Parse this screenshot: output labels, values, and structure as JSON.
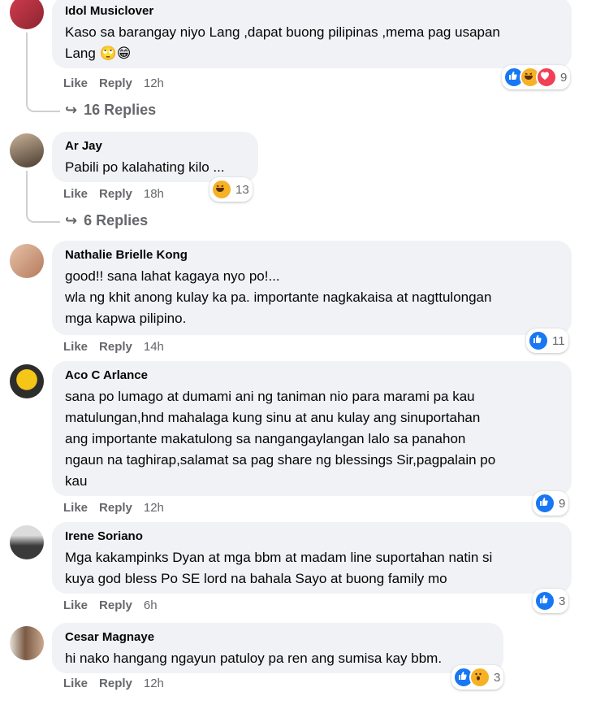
{
  "actions": {
    "like_label": "Like",
    "reply_label": "Reply"
  },
  "comments": [
    {
      "author": "Idol Musiclover",
      "text": "Kaso sa barangay niyo Lang ,dapat buong pilipinas ,mema pag usapan\nLang 🙄😁",
      "time": "12h",
      "reactions": [
        "like-icon",
        "haha-icon",
        "love-icon"
      ],
      "reaction_count": "9",
      "replies": "16 Replies"
    },
    {
      "author": "Ar Jay",
      "text": "Pabili po kalahating kilo ...",
      "time": "18h",
      "reactions": [
        "haha-icon"
      ],
      "reaction_count": "13",
      "replies": "6 Replies"
    },
    {
      "author": "Nathalie Brielle Kong",
      "text": "good!! sana lahat kagaya nyo po!...\nwla ng khit anong kulay ka pa. importante nagkakaisa at nagttulongan\nmga kapwa pilipino.",
      "time": "14h",
      "reactions": [
        "like-icon"
      ],
      "reaction_count": "11"
    },
    {
      "author": "Aco C Arlance",
      "text": "sana po lumago at dumami ani ng taniman nio para marami pa kau\nmatulungan,hnd mahalaga kung sinu at anu kulay ang sinuportahan\nang importante makatulong sa nangangaylangan lalo sa panahon\nngaun na taghirap,salamat sa pag share ng blessings Sir,pagpalain po\nkau",
      "time": "12h",
      "reactions": [
        "like-icon"
      ],
      "reaction_count": "9"
    },
    {
      "author": "Irene Soriano",
      "text": "Mga kakampinks Dyan at mga bbm at madam line suportahan natin si\nkuya god bless Po SE lord na bahala Sayo at buong family mo",
      "time": "6h",
      "reactions": [
        "like-icon"
      ],
      "reaction_count": "3"
    },
    {
      "author": "Cesar Magnaye",
      "text": "hi nako hangang ngayun patuloy pa ren ang sumisa kay bbm.",
      "time": "12h",
      "reactions": [
        "like-icon",
        "wow-icon"
      ],
      "reaction_count": "3"
    }
  ],
  "colors": {
    "like": "#1877f2",
    "haha": "#f7b125",
    "love": "#f33e58",
    "bubble": "#f0f2f5",
    "meta": "#65676b"
  }
}
